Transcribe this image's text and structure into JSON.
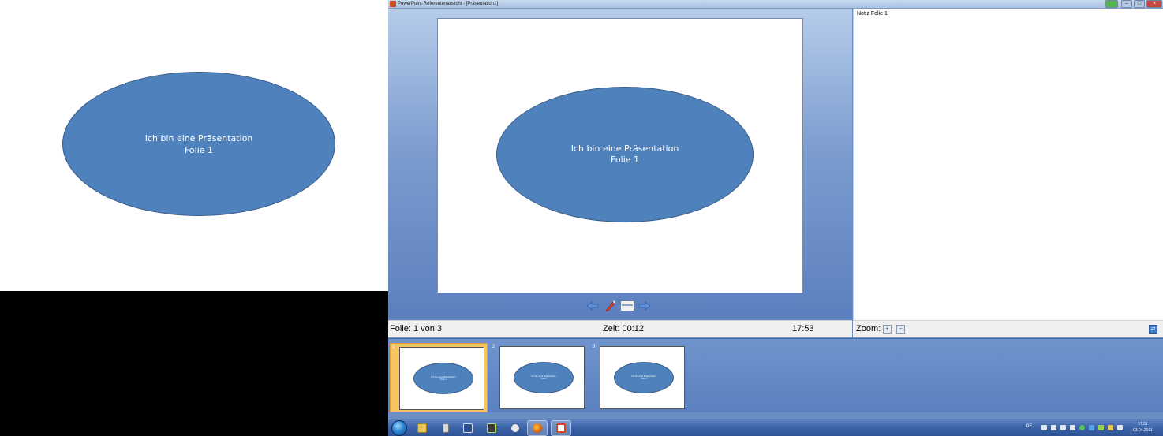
{
  "audience_slide": {
    "line1": "Ich bin eine Präsentation",
    "line2": "Folie 1"
  },
  "window": {
    "title": "PowerPoint-Referentenansicht - [Präsentation1]",
    "controls": {
      "minimize": "–",
      "maximize": "□",
      "close": "×"
    }
  },
  "current_slide": {
    "line1": "Ich bin eine Präsentation",
    "line2": "Folie 1"
  },
  "slide_tools": [
    "previous-icon",
    "pen-icon",
    "menu-icon",
    "next-icon"
  ],
  "status": {
    "slide": "Folie: 1 von 3",
    "time": "Zeit: 00:12",
    "clock": "17:53"
  },
  "notes": {
    "text": "Notiz Folie 1"
  },
  "zoom": {
    "label": "Zoom:",
    "zoom_in": "+",
    "zoom_out": "−"
  },
  "thumbnails": [
    {
      "number": "1",
      "line1": "Ich bin eine Präsentation",
      "line2": "Folie 1",
      "selected": true
    },
    {
      "number": "2",
      "line1": "Ich bin eine Präsentation",
      "line2": "Folie 2",
      "selected": false
    },
    {
      "number": "3",
      "line1": "Ich bin eine Präsentation",
      "line2": "Folie 3",
      "selected": false
    }
  ],
  "taskbar": {
    "apps": [
      "explorer-icon",
      "usb-icon",
      "save-icon",
      "network-icon",
      "media-icon",
      "firefox-icon",
      "powerpoint-icon"
    ],
    "language": "DE",
    "time": "17:51",
    "date": "03.04.2011"
  },
  "colors": {
    "slide_shape": "#4f81bd",
    "selected_thumb": "#f6c461",
    "stage_top": "#b6ccea",
    "stage_bottom": "#5b7fbf"
  }
}
